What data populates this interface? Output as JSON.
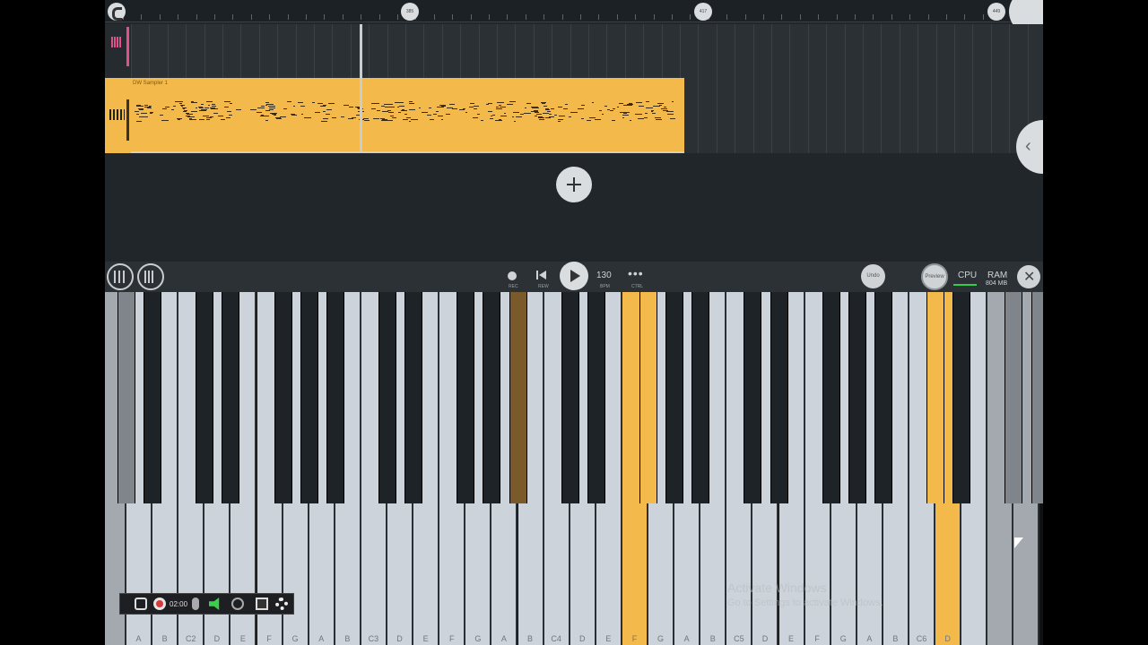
{
  "timeline": {
    "markers": [
      "385",
      "417",
      "449"
    ]
  },
  "playlist": {
    "clip_name": "DW Sampler 1"
  },
  "transport": {
    "rec_label": "REC",
    "rew_label": "REW",
    "bpm_value": "130",
    "bpm_label": "BPM",
    "ctrl_label": "CTRL",
    "undo_label": "Undo",
    "preview_label": "Preview",
    "cpu_label": "CPU",
    "ram_label": "RAM",
    "ram_value": "804 MB"
  },
  "keyboard": {
    "white_labels": [
      "A",
      "B",
      "C2",
      "D",
      "E",
      "F",
      "G",
      "A",
      "B",
      "C3",
      "D",
      "E",
      "F",
      "G",
      "A",
      "B",
      "C4",
      "D",
      "E",
      "F",
      "G",
      "A",
      "B",
      "C5",
      "D",
      "E",
      "F",
      "G",
      "A",
      "B",
      "C6",
      "D"
    ]
  },
  "watermark": {
    "line1": "Activate Windows",
    "line2": "Go to Settings to activate Windows."
  },
  "recorder": {
    "time": "02:00"
  },
  "colors": {
    "accent": "#f3b94b",
    "background": "#21262b",
    "selected_pink": "#e0508a",
    "cpu_green": "#2fcf4d"
  }
}
